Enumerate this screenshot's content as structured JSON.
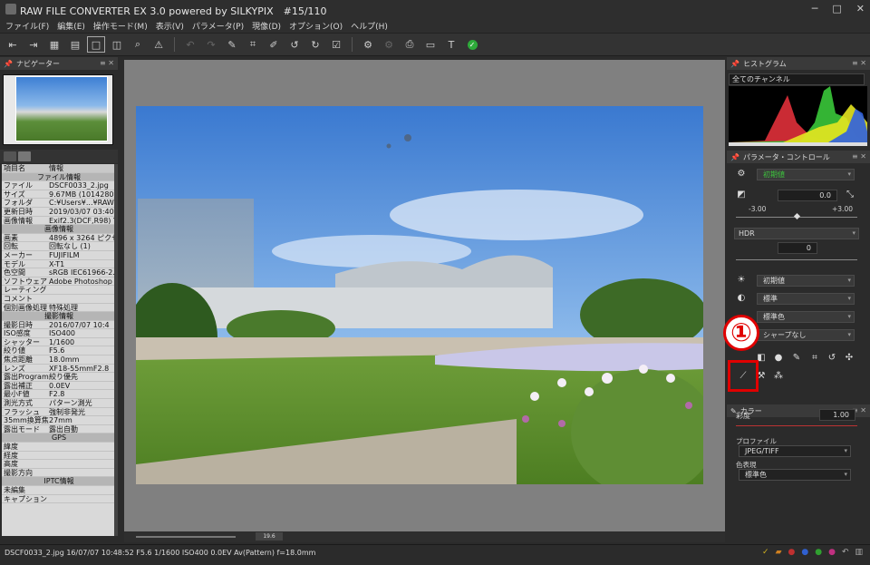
{
  "window": {
    "title": "RAW FILE CONVERTER EX 3.0 powered by SILKYPIX　#15/110",
    "controls": [
      "─",
      "□",
      "✕"
    ]
  },
  "menu": [
    "ファイル(F)",
    "編集(E)",
    "操作モード(M)",
    "表示(V)",
    "パラメータ(P)",
    "現像(D)",
    "オプション(O)",
    "ヘルプ(H)"
  ],
  "navigator": {
    "title": "ナビゲーター"
  },
  "info": {
    "col_item": "項目名",
    "col_info": "情報",
    "rows": [
      {
        "type": "sec",
        "k": "ファイル情報"
      },
      {
        "k": "ファイル",
        "v": "DSCF0033_2.jpg"
      },
      {
        "k": "サイズ",
        "v": "9.67MB (10142809"
      },
      {
        "k": "フォルダ",
        "v": "C:¥Users¥...¥RAW"
      },
      {
        "k": "更新日時",
        "v": "2019/03/07 03:40:"
      },
      {
        "k": "画像情報",
        "v": "Exif2.3(DCF,R98) Y"
      },
      {
        "type": "sec",
        "k": "画像情報"
      },
      {
        "k": "画素",
        "v": "4896 x 3264 ピクセ"
      },
      {
        "k": "回転",
        "v": "回転なし (1)"
      },
      {
        "k": "メーカー",
        "v": "FUJIFILM"
      },
      {
        "k": "モデル",
        "v": "X-T1"
      },
      {
        "k": "色空間",
        "v": "sRGB IEC61966-2."
      },
      {
        "k": "ソフトウェア",
        "v": "Adobe Photoshop C"
      },
      {
        "k": "レーティング",
        "v": ""
      },
      {
        "k": "コメント",
        "v": ""
      },
      {
        "k": "個別画像処理",
        "v": "特殊処理"
      },
      {
        "type": "sec",
        "k": "撮影情報"
      },
      {
        "k": "撮影日時",
        "v": "2016/07/07 10:4"
      },
      {
        "k": "ISO感度",
        "v": "ISO400"
      },
      {
        "k": "シャッター",
        "v": "1/1600"
      },
      {
        "k": "絞り値",
        "v": "F5.6"
      },
      {
        "k": "焦点距離",
        "v": "18.0mm"
      },
      {
        "k": "レンズ",
        "v": "XF18-55mmF2.8"
      },
      {
        "k": "露出Program",
        "v": "絞り優先"
      },
      {
        "k": "露出補正",
        "v": "0.0EV"
      },
      {
        "k": "最小F値",
        "v": "F2.8"
      },
      {
        "k": "測光方式",
        "v": "パターン測光"
      },
      {
        "k": "フラッシュ",
        "v": "強制非発光"
      },
      {
        "k": "35mm換算焦点",
        "v": "27mm"
      },
      {
        "k": "露出モード",
        "v": "露出自動"
      },
      {
        "type": "sec",
        "k": "GPS"
      },
      {
        "k": "緯度",
        "v": ""
      },
      {
        "k": "経度",
        "v": ""
      },
      {
        "k": "高度",
        "v": ""
      },
      {
        "k": "撮影方向",
        "v": ""
      },
      {
        "type": "sec",
        "k": "IPTC情報"
      },
      {
        "k": "未編集",
        "v": ""
      },
      {
        "k": "キャプション",
        "v": ""
      }
    ]
  },
  "viewer": {
    "zoom": "19.6"
  },
  "histogram": {
    "title": "ヒストグラム",
    "channel": "全てのチャンネル"
  },
  "params": {
    "title": "パラメータ・コントロール",
    "preset": "初期値",
    "exposure": "0.0",
    "exp_min": "-3.00",
    "exp_max": "+3.00",
    "hdr": "HDR",
    "hdr_val": "0",
    "wb": "初期値",
    "tone": "標準",
    "color": "標準色",
    "sharp": "シャープなし"
  },
  "badge": "①",
  "color_panel": {
    "title": "カラー",
    "saturation_label": "彩度",
    "saturation": "1.00",
    "profile_label": "プロファイル",
    "profile": "JPEG/TIFF",
    "colorrep_label": "色表現",
    "colorrep": "標準色"
  },
  "status": "DSCF0033_2.jpg 16/07/07 10:48:52 F5.6 1/1600 ISO400  0.0EV Av(Pattern) f=18.0mm"
}
